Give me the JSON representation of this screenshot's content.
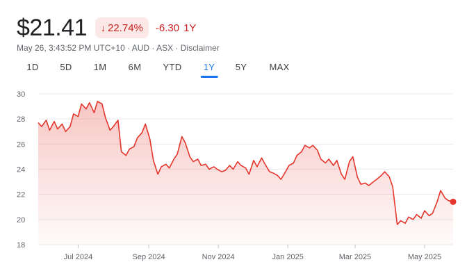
{
  "quote": {
    "price": "$21.41",
    "change_pct": "22.74%",
    "change_abs": "-6.30",
    "period": "1Y",
    "down_arrow_icon": "arrow-down-icon",
    "meta": "May 26, 3:43:52 PM UTC+10 · AUD · ASX · Disclaimer"
  },
  "tabs": [
    {
      "label": "1D",
      "active": false
    },
    {
      "label": "5D",
      "active": false
    },
    {
      "label": "1M",
      "active": false
    },
    {
      "label": "6M",
      "active": false
    },
    {
      "label": "YTD",
      "active": false
    },
    {
      "label": "1Y",
      "active": true
    },
    {
      "label": "5Y",
      "active": false
    },
    {
      "label": "MAX",
      "active": false
    }
  ],
  "colors": {
    "line": "#e3352b",
    "negative_text": "#c5221f",
    "negative_bg": "#fce8e6",
    "active_tab": "#1a73e8",
    "grid": "#e8eaed"
  },
  "chart_data": {
    "type": "area",
    "xlabel": "",
    "ylabel": "",
    "ylim": [
      18,
      30
    ],
    "yticks": [
      18,
      20,
      22,
      24,
      26,
      28,
      30
    ],
    "xticks": [
      {
        "label": "Jul 2024",
        "date": "2024-07-01"
      },
      {
        "label": "Sep 2024",
        "date": "2024-09-01"
      },
      {
        "label": "Nov 2024",
        "date": "2024-11-01"
      },
      {
        "label": "Jan 2025",
        "date": "2025-01-01"
      },
      {
        "label": "Mar 2025",
        "date": "2025-03-01"
      },
      {
        "label": "May 2025",
        "date": "2025-05-01"
      }
    ],
    "grid": "horizontal",
    "legend": "none",
    "series": [
      {
        "points": [
          [
            "2024-05-27",
            27.7
          ],
          [
            "2024-05-30",
            27.4
          ],
          [
            "2024-06-03",
            27.9
          ],
          [
            "2024-06-06",
            27.1
          ],
          [
            "2024-06-10",
            27.8
          ],
          [
            "2024-06-13",
            27.2
          ],
          [
            "2024-06-17",
            27.6
          ],
          [
            "2024-06-20",
            27.0
          ],
          [
            "2024-06-24",
            27.4
          ],
          [
            "2024-06-27",
            28.4
          ],
          [
            "2024-07-01",
            28.2
          ],
          [
            "2024-07-04",
            29.2
          ],
          [
            "2024-07-08",
            28.8
          ],
          [
            "2024-07-11",
            29.3
          ],
          [
            "2024-07-15",
            28.5
          ],
          [
            "2024-07-18",
            29.4
          ],
          [
            "2024-07-22",
            29.2
          ],
          [
            "2024-07-25",
            28.1
          ],
          [
            "2024-07-29",
            27.1
          ],
          [
            "2024-08-01",
            27.4
          ],
          [
            "2024-08-05",
            27.9
          ],
          [
            "2024-08-08",
            25.4
          ],
          [
            "2024-08-12",
            25.1
          ],
          [
            "2024-08-15",
            25.6
          ],
          [
            "2024-08-19",
            25.8
          ],
          [
            "2024-08-22",
            26.5
          ],
          [
            "2024-08-26",
            26.9
          ],
          [
            "2024-08-29",
            27.6
          ],
          [
            "2024-09-02",
            26.4
          ],
          [
            "2024-09-05",
            24.7
          ],
          [
            "2024-09-09",
            23.6
          ],
          [
            "2024-09-12",
            24.2
          ],
          [
            "2024-09-16",
            24.4
          ],
          [
            "2024-09-19",
            24.1
          ],
          [
            "2024-09-23",
            24.8
          ],
          [
            "2024-09-26",
            25.2
          ],
          [
            "2024-09-30",
            26.6
          ],
          [
            "2024-10-03",
            26.1
          ],
          [
            "2024-10-07",
            25.0
          ],
          [
            "2024-10-10",
            24.6
          ],
          [
            "2024-10-14",
            24.8
          ],
          [
            "2024-10-17",
            24.3
          ],
          [
            "2024-10-21",
            24.4
          ],
          [
            "2024-10-24",
            24.0
          ],
          [
            "2024-10-28",
            24.2
          ],
          [
            "2024-10-31",
            24.0
          ],
          [
            "2024-11-04",
            23.8
          ],
          [
            "2024-11-07",
            23.9
          ],
          [
            "2024-11-11",
            24.3
          ],
          [
            "2024-11-14",
            24.0
          ],
          [
            "2024-11-18",
            24.6
          ],
          [
            "2024-11-21",
            24.3
          ],
          [
            "2024-11-25",
            24.1
          ],
          [
            "2024-11-28",
            23.6
          ],
          [
            "2024-12-02",
            24.7
          ],
          [
            "2024-12-05",
            24.2
          ],
          [
            "2024-12-09",
            24.9
          ],
          [
            "2024-12-12",
            24.4
          ],
          [
            "2024-12-16",
            23.8
          ],
          [
            "2024-12-19",
            23.7
          ],
          [
            "2024-12-23",
            23.5
          ],
          [
            "2024-12-26",
            23.2
          ],
          [
            "2024-12-30",
            23.8
          ],
          [
            "2025-01-02",
            24.3
          ],
          [
            "2025-01-06",
            24.5
          ],
          [
            "2025-01-09",
            25.1
          ],
          [
            "2025-01-13",
            25.4
          ],
          [
            "2025-01-16",
            25.9
          ],
          [
            "2025-01-20",
            25.7
          ],
          [
            "2025-01-23",
            25.9
          ],
          [
            "2025-01-27",
            25.5
          ],
          [
            "2025-01-30",
            24.8
          ],
          [
            "2025-02-03",
            24.5
          ],
          [
            "2025-02-06",
            24.8
          ],
          [
            "2025-02-10",
            24.3
          ],
          [
            "2025-02-13",
            24.7
          ],
          [
            "2025-02-17",
            23.6
          ],
          [
            "2025-02-20",
            23.2
          ],
          [
            "2025-02-24",
            24.6
          ],
          [
            "2025-02-27",
            25.0
          ],
          [
            "2025-03-03",
            23.4
          ],
          [
            "2025-03-06",
            22.8
          ],
          [
            "2025-03-10",
            22.9
          ],
          [
            "2025-03-13",
            22.7
          ],
          [
            "2025-03-17",
            23.0
          ],
          [
            "2025-03-20",
            23.2
          ],
          [
            "2025-03-24",
            23.5
          ],
          [
            "2025-03-27",
            23.8
          ],
          [
            "2025-03-31",
            23.4
          ],
          [
            "2025-04-03",
            22.6
          ],
          [
            "2025-04-07",
            19.6
          ],
          [
            "2025-04-10",
            19.9
          ],
          [
            "2025-04-14",
            19.7
          ],
          [
            "2025-04-17",
            20.2
          ],
          [
            "2025-04-21",
            20.0
          ],
          [
            "2025-04-24",
            20.4
          ],
          [
            "2025-04-28",
            20.1
          ],
          [
            "2025-05-01",
            20.7
          ],
          [
            "2025-05-05",
            20.3
          ],
          [
            "2025-05-08",
            20.5
          ],
          [
            "2025-05-12",
            21.4
          ],
          [
            "2025-05-15",
            22.3
          ],
          [
            "2025-05-19",
            21.7
          ],
          [
            "2025-05-22",
            21.5
          ],
          [
            "2025-05-26",
            21.41
          ]
        ]
      }
    ]
  }
}
